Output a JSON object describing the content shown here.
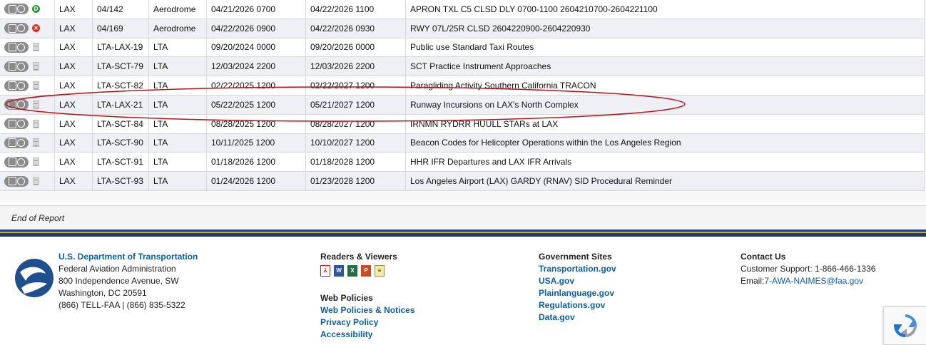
{
  "rows": [
    {
      "status": "green",
      "status_glyph": "D",
      "location": "LAX",
      "number": "04/142",
      "type": "Aerodrome",
      "start": "04/21/2026 0700",
      "end": "04/22/2026 1100",
      "text": "APRON TXL C5 CLSD DLY 0700-1100 2604210700-2604221100"
    },
    {
      "status": "red",
      "status_glyph": "✕",
      "location": "LAX",
      "number": "04/169",
      "type": "Aerodrome",
      "start": "04/22/2026 0900",
      "end": "04/22/2026 0930",
      "text": "RWY 07L/25R CLSD 2604220900-2604220930"
    },
    {
      "status": "page",
      "location": "LAX",
      "number": "LTA-LAX-19",
      "type": "LTA",
      "start": "09/20/2024 0000",
      "end": "09/20/2026 0000",
      "text": "Public use Standard Taxi Routes"
    },
    {
      "status": "page",
      "location": "LAX",
      "number": "LTA-SCT-79",
      "type": "LTA",
      "start": "12/03/2024 2200",
      "end": "12/03/2026 2200",
      "text": "SCT Practice Instrument Approaches"
    },
    {
      "status": "page",
      "location": "LAX",
      "number": "LTA-SCT-82",
      "type": "LTA",
      "start": "02/22/2025 1200",
      "end": "02/22/2027 1200",
      "text": "Paragliding Activity Southern California TRACON"
    },
    {
      "status": "page",
      "location": "LAX",
      "number": "LTA-LAX-21",
      "type": "LTA",
      "start": "05/22/2025 1200",
      "end": "05/21/2027 1200",
      "text": "Runway Incursions on LAX's North Complex"
    },
    {
      "status": "page",
      "location": "LAX",
      "number": "LTA-SCT-84",
      "type": "LTA",
      "start": "08/28/2025 1200",
      "end": "08/28/2027 1200",
      "text": "IRNMN RYDRR HUULL STARs at LAX"
    },
    {
      "status": "page",
      "location": "LAX",
      "number": "LTA-SCT-90",
      "type": "LTA",
      "start": "10/11/2025 1200",
      "end": "10/10/2027 1200",
      "text": "Beacon Codes for Helicopter Operations within the Los Angeles Region"
    },
    {
      "status": "page",
      "location": "LAX",
      "number": "LTA-SCT-91",
      "type": "LTA",
      "start": "01/18/2026 1200",
      "end": "01/18/2028 1200",
      "text": "HHR IFR Departures and LAX IFR Arrivals"
    },
    {
      "status": "page",
      "location": "LAX",
      "number": "LTA-SCT-93",
      "type": "LTA",
      "start": "01/24/2026 1200",
      "end": "01/23/2028 1200",
      "text": "Los Angeles Airport (LAX) GARDY (RNAV) SID Procedural Reminder"
    }
  ],
  "highlighted_row": "LTA-LAX-21",
  "annotation_color": "#b3161d",
  "end_of_report": "End of Report",
  "footer": {
    "dot": {
      "link": "U.S. Department of Transportation",
      "lines": [
        "Federal Aviation Administration",
        "800 Independence Avenue, SW",
        "Washington, DC 20591",
        "(866) TELL-FAA | (866) 835-5322"
      ]
    },
    "readers": {
      "heading": "Readers & Viewers",
      "icons": [
        "pdf-icon",
        "word-icon",
        "excel-icon",
        "powerpoint-icon",
        "notepad-icon"
      ]
    },
    "web_policies": {
      "heading": "Web Policies",
      "links": [
        "Web Policies & Notices",
        "Privacy Policy",
        "Accessibility"
      ]
    },
    "gov_sites": {
      "heading": "Government Sites",
      "links": [
        "Transportation.gov",
        "USA.gov",
        "Plainlanguage.gov",
        "Regulations.gov",
        "Data.gov"
      ]
    },
    "contact": {
      "heading": "Contact Us",
      "support": "Customer Support: 1-866-466-1336",
      "email_label": "Email:",
      "email": "7-AWA-NAIMES@faa.gov"
    }
  },
  "colors": {
    "link": "#0a5fa8",
    "row_alt": "#eef0f5",
    "stripe_navy": "#1a3a70",
    "stripe_gold": "#d9a82e"
  }
}
